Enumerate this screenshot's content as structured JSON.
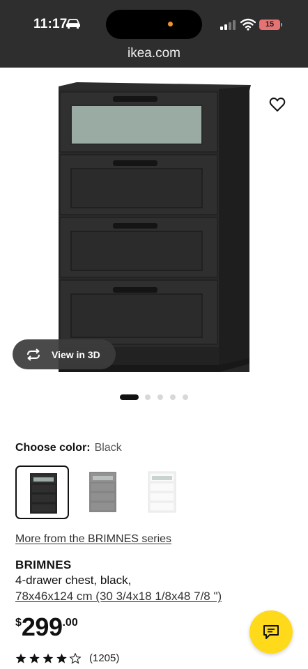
{
  "status_bar": {
    "time": "11:17",
    "battery_level": "15"
  },
  "browser": {
    "url": "ikea.com"
  },
  "gallery": {
    "view_in_3d_label": "View in 3D",
    "image_count": 5,
    "current_image": 1
  },
  "color": {
    "label": "Choose color:",
    "selected": "Black",
    "options": [
      "Black",
      "Gray",
      "White"
    ]
  },
  "series_link": "More from the BRIMNES series",
  "product": {
    "name": "BRIMNES",
    "description": "4-drawer chest, black,",
    "dimensions": "78x46x124 cm (30 3/4x18 1/8x48 7/8 \")"
  },
  "price": {
    "currency": "$",
    "integer": "299",
    "decimal": ".00"
  },
  "rating": {
    "stars": 4.5,
    "count_text": "(1205)"
  },
  "colors": {
    "status_bar_bg": "#2e2e2e",
    "chat_button": "#ffda1a",
    "battery": "#e57373",
    "recording_dot": "#f0932b"
  }
}
